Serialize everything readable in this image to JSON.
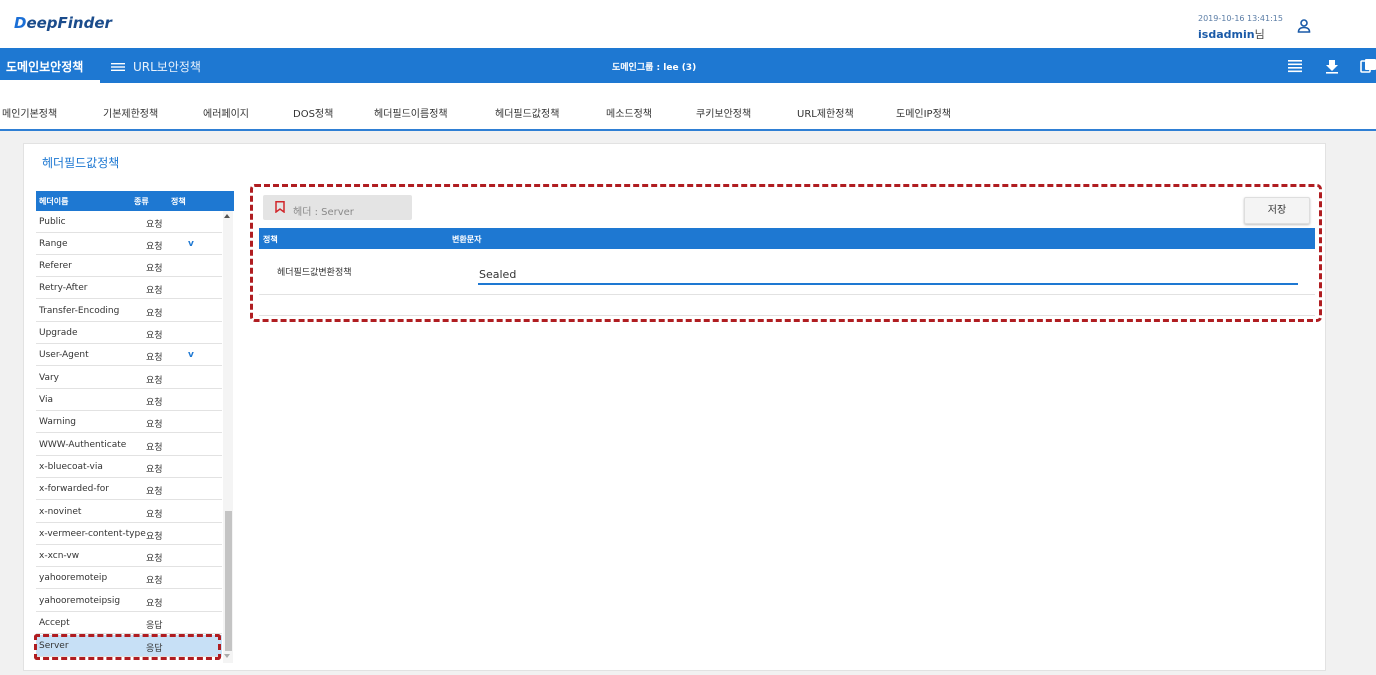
{
  "app": {
    "logo_mark": "D",
    "logo_text": "eepFinder",
    "datetime": "2019-10-16 13:41:15",
    "username": "isdadmin",
    "username_suffix": "님"
  },
  "topnav": {
    "tab_domain": "도메인보안정책",
    "tab_url": "URL보안정책",
    "domain_group": "도메인그룹 : lee (3)"
  },
  "subnav": {
    "items": [
      "메인기본정책",
      "기본제한정책",
      "에러페이지",
      "DOS정책",
      "헤더필드이름정책",
      "헤더필드값정책",
      "메소드정책",
      "쿠키보안정책",
      "URL제한정책",
      "도메인IP정책"
    ]
  },
  "panel": {
    "title": "헤더필드값정책"
  },
  "header_list": {
    "columns": [
      "헤더이름",
      "종류",
      "정책"
    ],
    "rows": [
      {
        "name": "Public",
        "type": "요청",
        "policy": ""
      },
      {
        "name": "Range",
        "type": "요청",
        "policy": "v"
      },
      {
        "name": "Referer",
        "type": "요청",
        "policy": ""
      },
      {
        "name": "Retry-After",
        "type": "요청",
        "policy": ""
      },
      {
        "name": "Transfer-Encoding",
        "type": "요청",
        "policy": ""
      },
      {
        "name": "Upgrade",
        "type": "요청",
        "policy": ""
      },
      {
        "name": "User-Agent",
        "type": "요청",
        "policy": "v"
      },
      {
        "name": "Vary",
        "type": "요청",
        "policy": ""
      },
      {
        "name": "Via",
        "type": "요청",
        "policy": ""
      },
      {
        "name": "Warning",
        "type": "요청",
        "policy": ""
      },
      {
        "name": "WWW-Authenticate",
        "type": "요청",
        "policy": ""
      },
      {
        "name": "x-bluecoat-via",
        "type": "요청",
        "policy": ""
      },
      {
        "name": "x-forwarded-for",
        "type": "요청",
        "policy": ""
      },
      {
        "name": "x-novinet",
        "type": "요청",
        "policy": ""
      },
      {
        "name": "x-vermeer-content-type",
        "type": "요청",
        "policy": ""
      },
      {
        "name": "x-xcn-vw",
        "type": "요청",
        "policy": ""
      },
      {
        "name": "yahooremoteip",
        "type": "요청",
        "policy": ""
      },
      {
        "name": "yahooremoteipsig",
        "type": "요청",
        "policy": ""
      },
      {
        "name": "Accept",
        "type": "응답",
        "policy": ""
      },
      {
        "name": "Server",
        "type": "응답",
        "policy": ""
      }
    ],
    "selected_index": 19
  },
  "detail": {
    "header_label": "헤더 : Server",
    "save_label": "저장",
    "columns": [
      "정책",
      "변환문자"
    ],
    "policy_name": "헤더필드값변환정책",
    "replace_value": "Sealed"
  },
  "colors": {
    "brand_blue": "#1e78d2",
    "highlight_red": "#b01d21",
    "selected_row": "#c7e0f6"
  }
}
